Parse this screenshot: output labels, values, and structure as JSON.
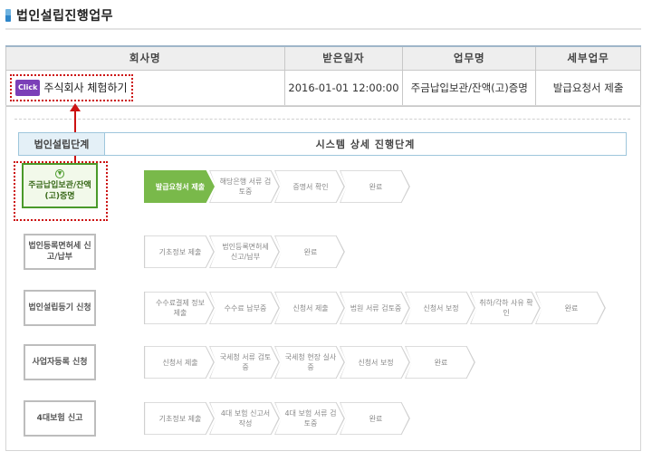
{
  "page": {
    "title": "법인설립진행업무"
  },
  "table": {
    "headers": [
      "회사명",
      "받은일자",
      "업무명",
      "세부업무"
    ],
    "row": {
      "click_badge": "Click",
      "company": "주식회사 체험하기",
      "date": "2016-01-01 12:00:00",
      "task": "주금납입보관/잔액(고)증명",
      "subtask": "발급요청서 제출"
    }
  },
  "detail": {
    "header_left": "법인설립단계",
    "header_right": "시스템 상세 진행단계"
  },
  "stages": [
    {
      "label": "주금납입보관/잔액(고)증명",
      "active": true,
      "steps": [
        {
          "label": "발급요청서 제출",
          "done": true
        },
        {
          "label": "해당은행 서류 검토중"
        },
        {
          "label": "증명서 확인"
        },
        {
          "label": "완료"
        }
      ]
    },
    {
      "label": "법인등록면허세 신고/납부",
      "steps": [
        {
          "label": "기초정보 제출"
        },
        {
          "label": "법인등록면허세 신고/납부"
        },
        {
          "label": "완료"
        }
      ]
    },
    {
      "label": "법인설립등기 신청",
      "steps": [
        {
          "label": "수수료결제 정보제출"
        },
        {
          "label": "수수료 납부중"
        },
        {
          "label": "신청서 제출"
        },
        {
          "label": "법원 서류 검토중"
        },
        {
          "label": "신청서 보정"
        },
        {
          "label": "취하/각하 사유 확인"
        },
        {
          "label": "완료"
        }
      ]
    },
    {
      "label": "사업자등록 신청",
      "steps": [
        {
          "label": "신청서 제출"
        },
        {
          "label": "국세청 서류 검토중"
        },
        {
          "label": "국세청 현장 실사중"
        },
        {
          "label": "신청서 보정"
        },
        {
          "label": "완료"
        }
      ]
    },
    {
      "label": "4대보험 신고",
      "steps": [
        {
          "label": "기초정보 제출"
        },
        {
          "label": "4대 보험 신고서 작성"
        },
        {
          "label": "4대 보험 서류 검토중"
        },
        {
          "label": "완료"
        }
      ]
    }
  ],
  "colors": {
    "accent_green": "#79b94a",
    "highlight_red": "#cc1111",
    "badge_purple": "#7b3fb8"
  }
}
